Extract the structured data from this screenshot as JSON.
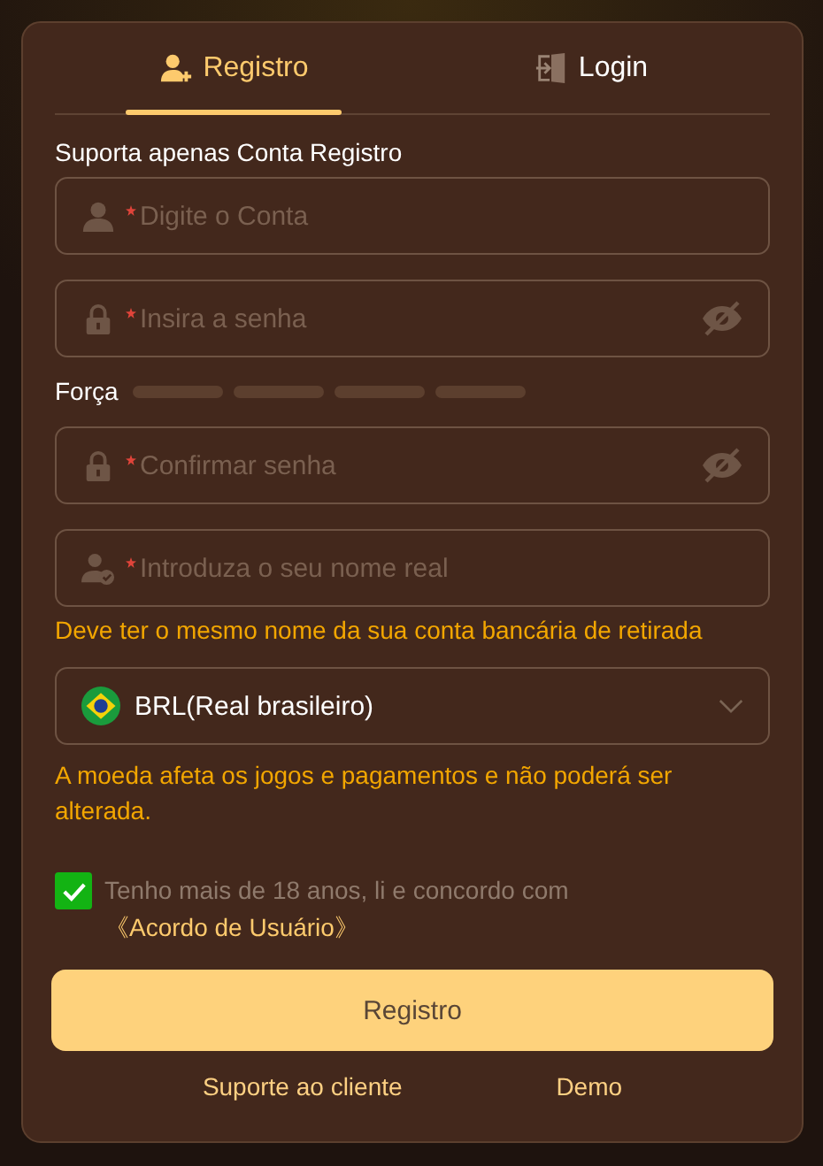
{
  "tabs": [
    {
      "label": "Registro",
      "kind": "register",
      "selected": true
    },
    {
      "label": "Login",
      "kind": "login",
      "selected": false
    }
  ],
  "intro": "Suporta apenas Conta Registro",
  "fields": [
    {
      "kind": "account",
      "placeholder": "Digite o Conta",
      "required": true
    },
    {
      "kind": "password",
      "placeholder": "Insira a senha",
      "required": true
    }
  ],
  "strength": {
    "label": "Força",
    "segments": [
      {
        "on": false
      },
      {
        "on": false
      },
      {
        "on": false
      },
      {
        "on": false
      }
    ]
  },
  "fields2": [
    {
      "kind": "password",
      "placeholder": "Confirmar senha",
      "required": true
    },
    {
      "kind": "realname",
      "placeholder": "Introduza o seu nome real",
      "required": true
    }
  ],
  "name_hint": "Deve ter o mesmo nome da sua conta bancária de retirada",
  "currency": {
    "value": "BRL(Real brasileiro)"
  },
  "currency_hint": "A moeda afeta os jogos e pagamentos e não poderá ser alterada.",
  "agreement": {
    "checked": true,
    "text": "Tenho mais de 18 anos, li e concordo com",
    "link": "《Acordo de Usuário》"
  },
  "submit": "Registro",
  "footer_links": [
    "Suporte ao cliente",
    "Demo"
  ]
}
